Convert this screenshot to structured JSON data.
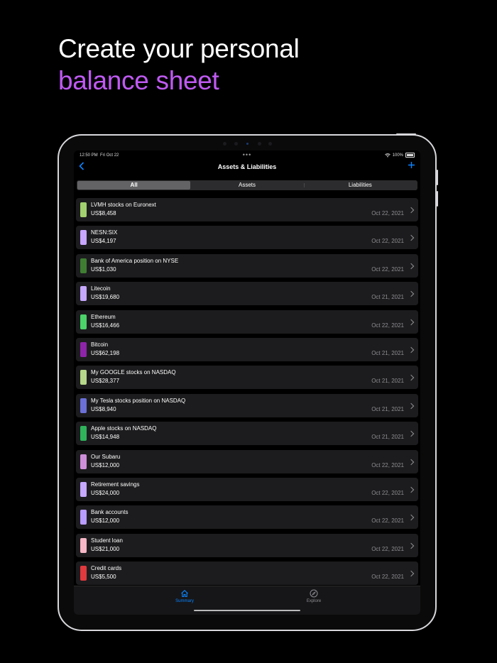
{
  "headline": {
    "line1": "Create your personal",
    "line2": "balance sheet"
  },
  "status_bar": {
    "time": "12:50 PM",
    "date": "Fri Oct 22",
    "battery": "100%"
  },
  "nav": {
    "title": "Assets & Liabilities",
    "back_icon": "chevron-left-icon",
    "add_icon": "plus-icon"
  },
  "segments": {
    "all": "All",
    "assets": "Assets",
    "liabilities": "Liabilities",
    "selected": "All"
  },
  "items": [
    {
      "name": "LVMH stocks on Euronext",
      "amount": "US$8,458",
      "date": "Oct 22, 2021",
      "color": "#a3d16f"
    },
    {
      "name": "NESN:SIX",
      "amount": "US$4,197",
      "date": "Oct 22, 2021",
      "color": "#c8a6ff"
    },
    {
      "name": "Bank of America position on NYSE",
      "amount": "US$1,030",
      "date": "Oct 22, 2021",
      "color": "#3f7d32"
    },
    {
      "name": "Litecoin",
      "amount": "US$19,680",
      "date": "Oct 21, 2021",
      "color": "#c6a8ff"
    },
    {
      "name": "Ethereum",
      "amount": "US$16,466",
      "date": "Oct 22, 2021",
      "color": "#4cd36a"
    },
    {
      "name": "Bitcoin",
      "amount": "US$62,198",
      "date": "Oct 21, 2021",
      "color": "#8e24aa"
    },
    {
      "name": "My GOOGLE stocks on NASDAQ",
      "amount": "US$28,377",
      "date": "Oct 21, 2021",
      "color": "#b6d88a"
    },
    {
      "name": "My Tesla stocks position on NASDAQ",
      "amount": "US$8,940",
      "date": "Oct 21, 2021",
      "color": "#6b6fd6"
    },
    {
      "name": "Apple stocks on NASDAQ",
      "amount": "US$14,948",
      "date": "Oct 21, 2021",
      "color": "#2fb35b"
    },
    {
      "name": "Our Subaru",
      "amount": "US$12,000",
      "date": "Oct 22, 2021",
      "color": "#ce8fd9"
    },
    {
      "name": "Retirement savings",
      "amount": "US$24,000",
      "date": "Oct 22, 2021",
      "color": "#c6a8ff"
    },
    {
      "name": "Bank accounts",
      "amount": "US$12,000",
      "date": "Oct 22, 2021",
      "color": "#b99cff"
    },
    {
      "name": "Student loan",
      "amount": "US$21,000",
      "date": "Oct 22, 2021",
      "color": "#f7b7c6"
    },
    {
      "name": "Credit cards",
      "amount": "US$5,500",
      "date": "Oct 22, 2021",
      "color": "#e0393e"
    }
  ],
  "tabbar": {
    "summary": {
      "label": "Summary",
      "icon": "house-icon"
    },
    "explore": {
      "label": "Explore",
      "icon": "compass-icon"
    }
  },
  "colors": {
    "accent": "#0a84ff",
    "headline_purple": "#bf5af2",
    "background": "#000000"
  }
}
